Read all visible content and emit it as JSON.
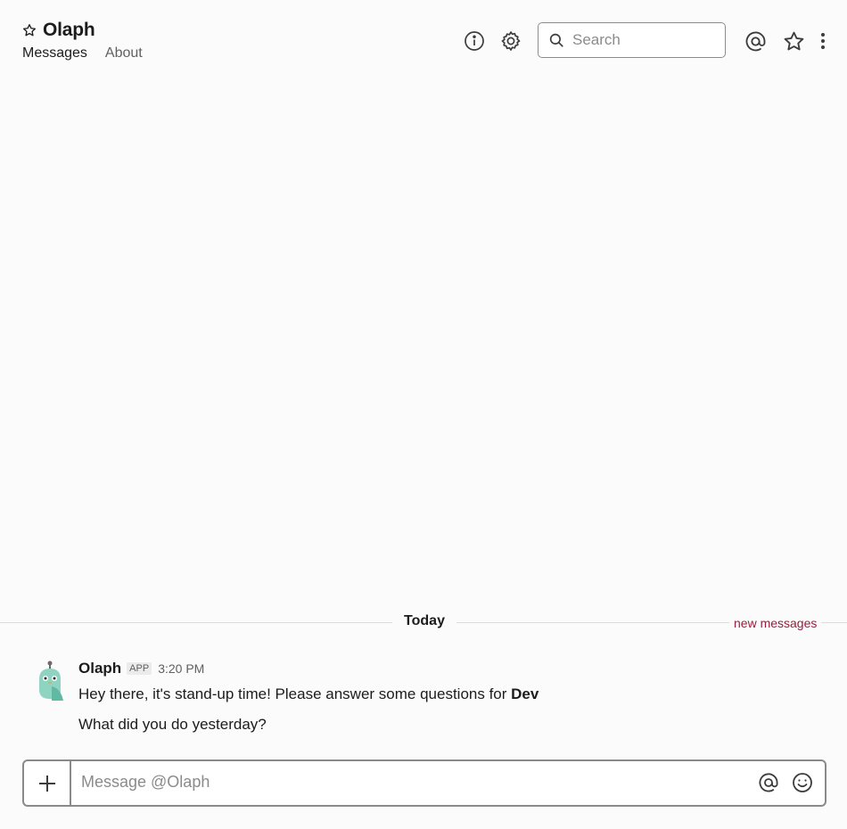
{
  "header": {
    "title": "Olaph",
    "tabs": [
      {
        "label": "Messages"
      },
      {
        "label": "About"
      }
    ],
    "search": {
      "placeholder": "Search",
      "value": ""
    },
    "icons": [
      "star-icon",
      "info-icon",
      "gear-icon",
      "search-icon",
      "at-icon",
      "star-outline-icon",
      "more-vertical-icon"
    ]
  },
  "divider": {
    "label": "Today",
    "new_messages": "new messages"
  },
  "message": {
    "sender": "Olaph",
    "badge": "APP",
    "time": "3:20 PM",
    "line1_prefix": "Hey there, it's stand-up time! Please answer some questions for ",
    "line1_bold": "Dev",
    "line2": "What did you do yesterday?"
  },
  "composer": {
    "placeholder": "Message @Olaph",
    "value": ""
  },
  "colors": {
    "background": "#fbfbfb",
    "new_messages": "#9b1c3b",
    "avatar_teal": "#7fcdbb"
  }
}
